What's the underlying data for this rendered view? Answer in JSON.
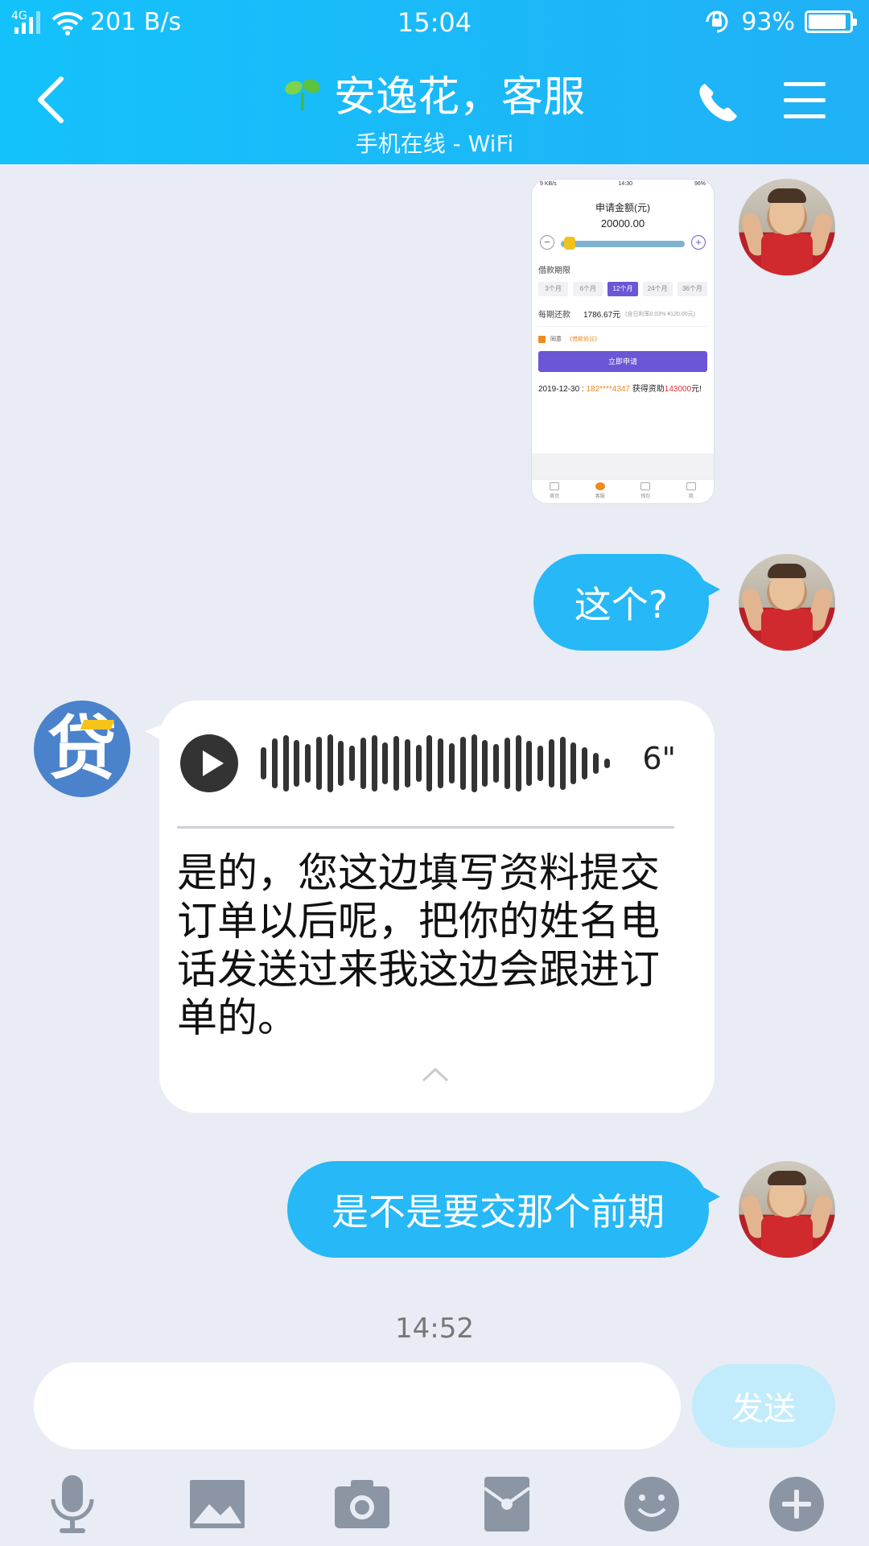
{
  "status_bar": {
    "network": "4G",
    "speed": "201 B/s",
    "time": "15:04",
    "battery": "93%"
  },
  "header": {
    "title": "安逸花，客服",
    "subtitle": "手机在线 - WiFi"
  },
  "shared_screenshot": {
    "status_left": "9 KB/s",
    "status_time": "14:30",
    "status_right": "96%",
    "amount_label": "申请金额(元)",
    "amount_value": "20000.00",
    "minus_symbol": "−",
    "plus_symbol": "+",
    "period_label": "借款期限",
    "periods": [
      "3个月",
      "6个月",
      "12个月",
      "24个月",
      "36个月"
    ],
    "selected_period": "12个月",
    "repay_label": "每期还款",
    "repay_value": "1786.67元",
    "repay_note": "(含日利率0.03% ¥120.00元)",
    "agree_text": "同意",
    "agree_link": "《借款协议》",
    "apply_button": "立即申请",
    "ticker_date": "2019-12-30 :",
    "ticker_phone": "182****4347",
    "ticker_mid": "获得资助",
    "ticker_amount": "143000",
    "ticker_unit": "元!",
    "tabs": [
      "首页",
      "客服",
      "钱包",
      "我"
    ]
  },
  "messages": {
    "msg1": "这个?",
    "voice_duration": "6\"",
    "voice_transcript": "是的，您这边填写资料提交订单以后呢，把你的姓名电话发送过来我这边会跟进订单的。",
    "bot_avatar_glyph": "贷",
    "msg2": "是不是要交那个前期"
  },
  "timestamp": "14:52",
  "input": {
    "value": "",
    "send_label": "发送"
  },
  "colors": {
    "header_gradient_start": "#14c2fb",
    "header_gradient_end": "#20b1f6",
    "bubble_blue": "#26b8f7",
    "background": "#e9ecf4",
    "send_disabled": "#c2ecfb",
    "screenshot_accent": "#6b56d6"
  },
  "toolbar": {
    "icons": [
      "microphone-icon",
      "image-icon",
      "camera-icon",
      "red-packet-icon",
      "emoji-icon",
      "plus-icon"
    ]
  }
}
